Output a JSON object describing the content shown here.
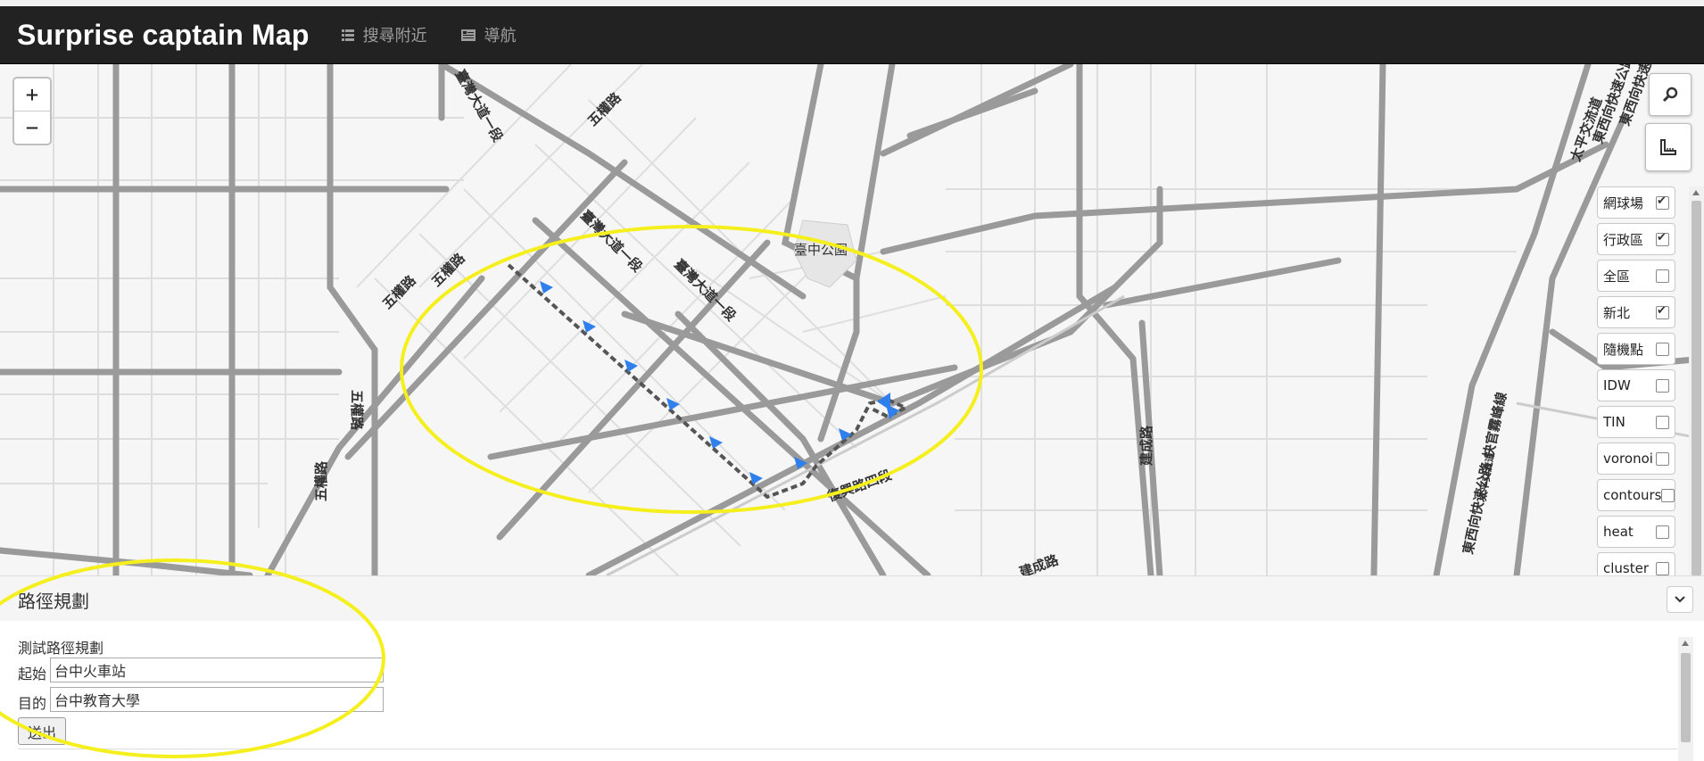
{
  "navbar": {
    "brand": "Surprise captain Map",
    "items": [
      {
        "label": "搜尋附近",
        "icon": "list-icon"
      },
      {
        "label": "導航",
        "icon": "navigation-icon"
      }
    ]
  },
  "map": {
    "zoom_in": "+",
    "zoom_out": "−",
    "labels": {
      "park": "臺中公園",
      "wuquan1": "五權路",
      "wuquan2": "五權路",
      "wuquan3": "五權路",
      "wuquan4": "五權路",
      "wuquanV": "五權路",
      "taiwan1": "臺灣大道一段",
      "taiwan2": "臺灣大道一段",
      "taiwanTop": "臺灣大道一段",
      "fuxing": "復興路四段",
      "jiancheng1": "建成路",
      "jiancheng2": "建成路",
      "east1": "東西向快速公路 快官霧峰線",
      "east2": "東西向快速公路",
      "east3": "東西向快速",
      "taiping": "太平交流道",
      "mid_small": "太平交流道"
    },
    "controls": [
      "search-icon",
      "ruler-icon"
    ]
  },
  "layers": [
    {
      "label": "網球場",
      "checked": true
    },
    {
      "label": "行政區",
      "checked": true
    },
    {
      "label": "全區",
      "checked": false
    },
    {
      "label": "新北",
      "checked": true
    },
    {
      "label": "隨機點",
      "checked": false
    },
    {
      "label": "IDW",
      "checked": false
    },
    {
      "label": "TIN",
      "checked": false
    },
    {
      "label": "voronoi",
      "checked": false
    },
    {
      "label": "contours",
      "checked": false
    },
    {
      "label": "heat",
      "checked": false
    },
    {
      "label": "cluster",
      "checked": false
    }
  ],
  "panel": {
    "title": "路徑規劃",
    "subtitle": "測試路徑規劃",
    "start_label": "起始",
    "start_value": "台中火車站",
    "dest_label": "目的",
    "dest_value": "台中教育大學",
    "submit": "送出"
  },
  "colors": {
    "navbar": "#222222",
    "route": "#555555",
    "arrow": "#2f80ed",
    "highlight": "#f5ef1e"
  }
}
